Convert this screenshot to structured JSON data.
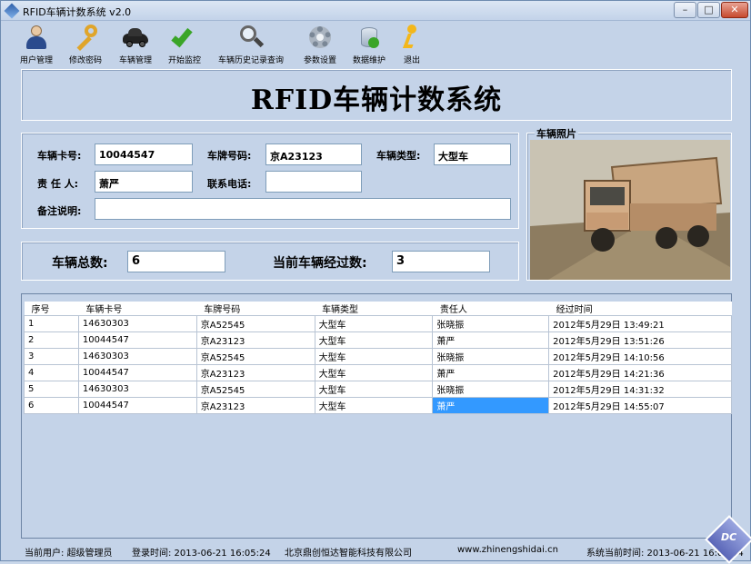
{
  "window": {
    "title": "RFID车辆计数系统 v2.0"
  },
  "toolbar": {
    "items": [
      {
        "label": "用户管理",
        "icon": "user-icon"
      },
      {
        "label": "修改密码",
        "icon": "key-icon"
      },
      {
        "label": "车辆管理",
        "icon": "car-icon"
      },
      {
        "label": "开始监控",
        "icon": "check-icon"
      },
      {
        "label": "车辆历史记录查询",
        "icon": "magnifier-icon"
      },
      {
        "label": "参数设置",
        "icon": "gear-icon"
      },
      {
        "label": "数据维护",
        "icon": "database-icon"
      },
      {
        "label": "退出",
        "icon": "exit-icon"
      }
    ]
  },
  "banner": {
    "title": "RFID车辆计数系统"
  },
  "info": {
    "card_label": "车辆卡号:",
    "card_value": "10044547",
    "plate_label": "车牌号码:",
    "plate_value": "京A23123",
    "type_label": "车辆类型:",
    "type_value": "大型车",
    "owner_label": "责 任 人:",
    "owner_value": "萧严",
    "phone_label": "联系电话:",
    "phone_value": "",
    "note_label": "备注说明:",
    "note_value": ""
  },
  "counts": {
    "total_label": "车辆总数:",
    "total_value": "6",
    "current_label": "当前车辆经过数:",
    "current_value": "3"
  },
  "photo": {
    "title": "车辆照片"
  },
  "grid": {
    "headers": [
      "序号",
      "车辆卡号",
      "车牌号码",
      "车辆类型",
      "责任人",
      "经过时间"
    ],
    "rows": [
      [
        "1",
        "14630303",
        "京A52545",
        "大型车",
        "张晓振",
        "2012年5月29日  13:49:21"
      ],
      [
        "2",
        "10044547",
        "京A23123",
        "大型车",
        "萧严",
        "2012年5月29日  13:51:26"
      ],
      [
        "3",
        "14630303",
        "京A52545",
        "大型车",
        "张晓振",
        "2012年5月29日  14:10:56"
      ],
      [
        "4",
        "10044547",
        "京A23123",
        "大型车",
        "萧严",
        "2012年5月29日  14:21:36"
      ],
      [
        "5",
        "14630303",
        "京A52545",
        "大型车",
        "张晓振",
        "2012年5月29日  14:31:32"
      ],
      [
        "6",
        "10044547",
        "京A23123",
        "大型车",
        "萧严",
        "2012年5月29日  14:55:07"
      ]
    ]
  },
  "status": {
    "user": "当前用户: 超级管理员",
    "login_time": "登录时间: 2013-06-21 16:05:24",
    "company": "北京鼎创恒达智能科技有限公司",
    "website": "www.zhinengshidai.cn",
    "sys_time": "系统当前时间: 2013-06-21 16:05:34"
  },
  "logo": {
    "text": "DC"
  }
}
